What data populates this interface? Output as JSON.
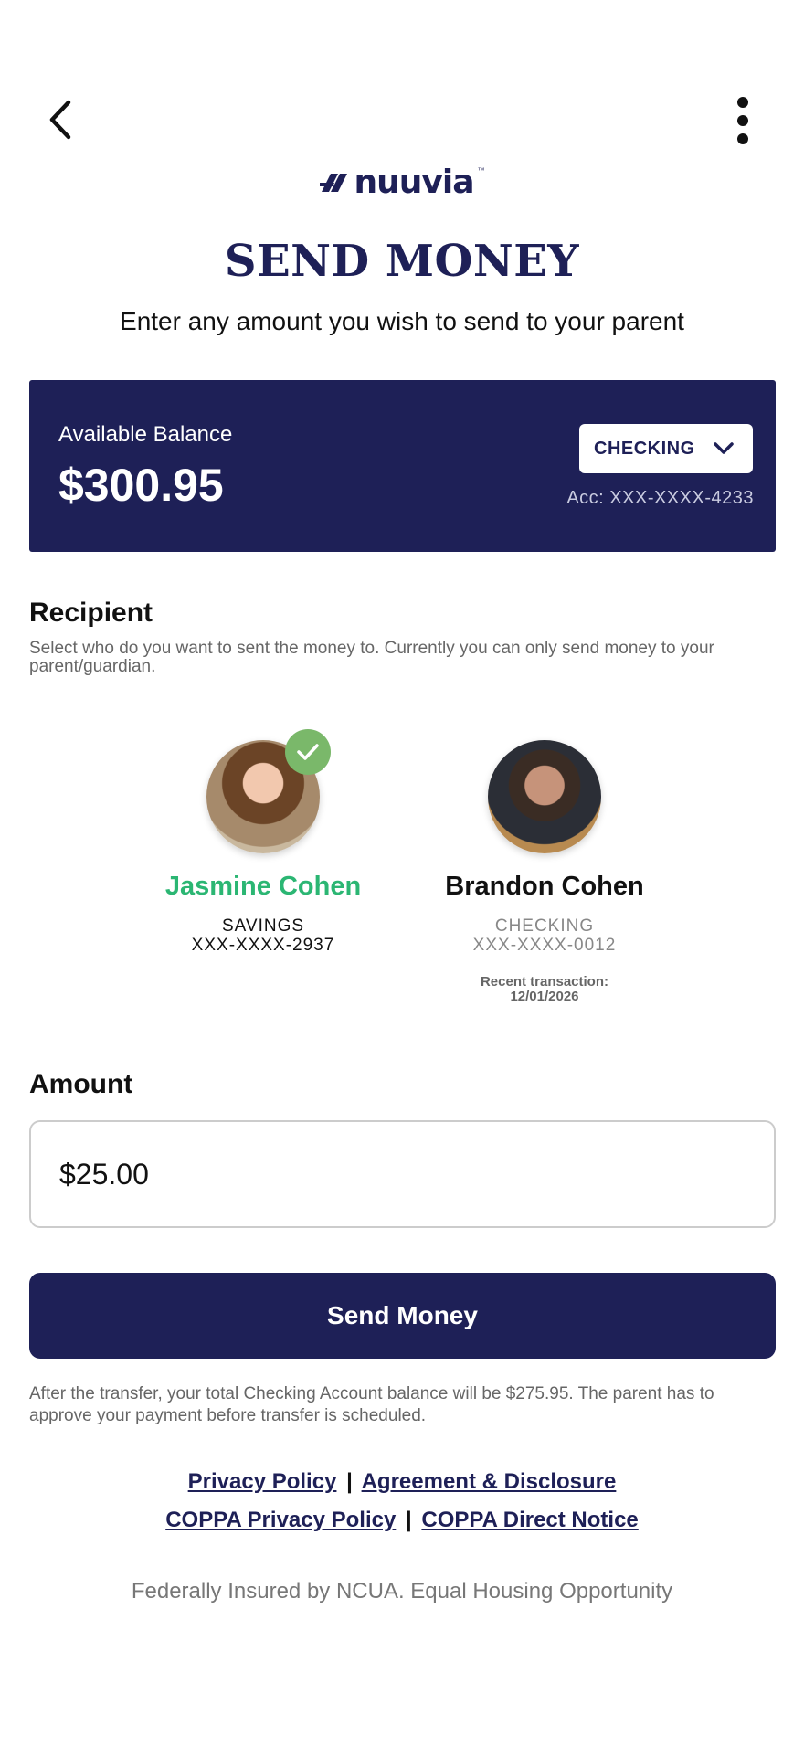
{
  "header": {
    "back_icon": "chevron-left-icon",
    "menu_icon": "more-vertical-icon",
    "logo_text": "nuuvia",
    "logo_tm": "™"
  },
  "page": {
    "title": "SEND MONEY",
    "subtitle": "Enter any amount you wish to send to your parent"
  },
  "balance": {
    "label": "Available Balance",
    "amount": "$300.95",
    "account_type": "CHECKING",
    "account_number": "Acc: XXX-XXXX-4233"
  },
  "recipients": {
    "title": "Recipient",
    "description": "Select who do you want to sent the money to. Currently you can only send money to your parent/guardian.",
    "items": [
      {
        "name": "Jasmine Cohen",
        "account_type": "SAVINGS",
        "account_number": "XXX-XXXX-2937",
        "selected": true
      },
      {
        "name": "Brandon Cohen",
        "account_type": "CHECKING",
        "account_number": "XXX-XXXX-0012",
        "recent_label": "Recent transaction:",
        "recent_date": "12/01/2026",
        "selected": false
      }
    ]
  },
  "amount": {
    "title": "Amount",
    "value": "$25.00"
  },
  "send_button_label": "Send Money",
  "transfer_note": "After the transfer, your total Checking Account balance will be $275.95. The parent has to approve your payment before transfer is scheduled.",
  "links": {
    "privacy_policy": "Privacy Policy",
    "agreement": "Agreement & Disclosure",
    "coppa_privacy": "COPPA Privacy Policy",
    "coppa_notice": "COPPA Direct Notice",
    "separator": "|"
  },
  "footer_note": "Federally Insured by NCUA. Equal Housing Opportunity",
  "colors": {
    "brand_navy": "#1e2057",
    "selected_green": "#2bb673",
    "check_green": "#7ab86a"
  }
}
